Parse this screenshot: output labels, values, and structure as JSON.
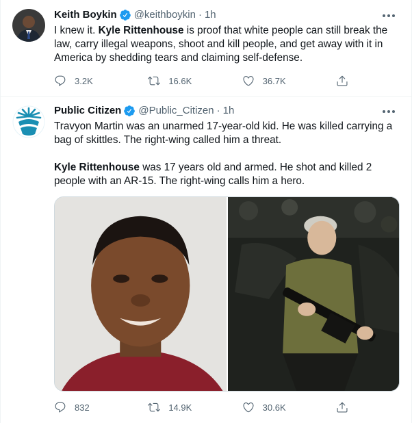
{
  "tweets": [
    {
      "author": {
        "name": "Keith Boykin",
        "handle": "@keithboykin",
        "time": "1h",
        "verified": true
      },
      "text": {
        "l1a": "I knew it. ",
        "l1b": "Kyle Rittenhouse",
        "l1c": " is proof that white people can still break the law, carry illegal weapons, shoot and kill people, and get away with it in America by shedding tears and claiming self-defense."
      },
      "actions": {
        "replies": "3.2K",
        "retweets": "16.6K",
        "likes": "36.7K"
      }
    },
    {
      "author": {
        "name": "Public Citizen",
        "handle": "@Public_Citizen",
        "time": "1h",
        "verified": true
      },
      "text": {
        "p1": "Travyon Martin was an unarmed 17-year-old kid. He was killed carrying a bag of skittles. The right-wing called him a threat.",
        "p2a": "Kyle Rittenhouse",
        "p2b": " was 17 years old and armed. He shot and killed 2 people with an AR-15. The right-wing calls him a hero."
      },
      "actions": {
        "replies": "832",
        "retweets": "14.9K",
        "likes": "30.6K"
      }
    }
  ],
  "colors": {
    "verified": "#1d9bf0",
    "muted": "#536471",
    "text": "#0f1419",
    "public_citizen_brand": "#1a8fb3"
  },
  "icons": [
    "verified-badge-icon",
    "more-icon",
    "reply-icon",
    "retweet-icon",
    "like-icon",
    "share-icon"
  ]
}
